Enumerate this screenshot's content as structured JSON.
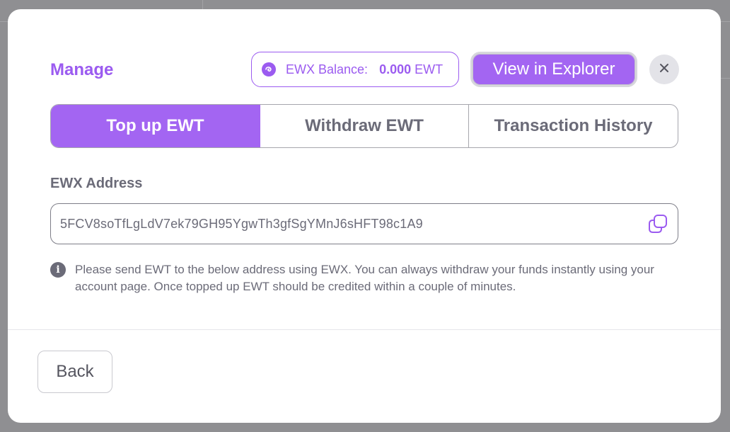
{
  "modal": {
    "title": "Manage",
    "balance": {
      "label": "EWX Balance:",
      "value": "0.000",
      "unit": "EWT",
      "icon": "ewx-logo-icon"
    },
    "explorer_button": "View in Explorer",
    "close_icon": "close-icon"
  },
  "tabs": [
    {
      "label": "Top up EWT",
      "active": true
    },
    {
      "label": "Withdraw EWT",
      "active": false
    },
    {
      "label": "Transaction History",
      "active": false
    }
  ],
  "address": {
    "label": "EWX Address",
    "value": "5FCV8soTfLgLdV7ek79GH95YgwTh3gfSgYMnJ6sHFT98c1A9",
    "copy_icon": "copy-icon"
  },
  "info": {
    "icon": "info-icon",
    "text": "Please send EWT to the below address using EWX. You can always withdraw your funds instantly using your account page. Once topped up EWT should be credited within a couple of minutes."
  },
  "footer": {
    "back_button": "Back"
  },
  "colors": {
    "accent": "#a365f2",
    "accent_text": "#9b5bf0",
    "muted_text": "#6b6b78",
    "overlay": "#8f8f92"
  }
}
